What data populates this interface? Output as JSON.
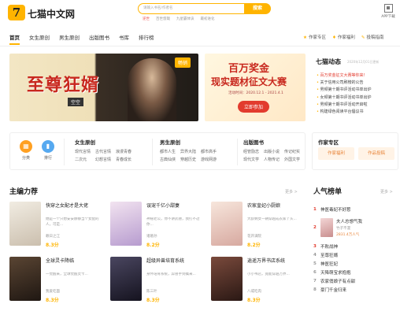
{
  "header": {
    "logo_mark": "7",
    "logo_text": "七猫中文网",
    "search_placeholder": "请输入书名/作者名",
    "search_button": "搜索",
    "hot_searches": [
      "逆世",
      "百世悠哉",
      "九星霸体诀",
      "最初进化"
    ],
    "app_download": "APP下载"
  },
  "nav": {
    "items": [
      "首页",
      "女生原创",
      "男生原创",
      "出版图书",
      "书库",
      "排行榜"
    ],
    "active_index": 0,
    "right_links": [
      {
        "icon": "★",
        "label": "作家专区"
      },
      {
        "icon": "♦",
        "label": "作家福利"
      },
      {
        "icon": "✎",
        "label": "投稿指南"
      }
    ]
  },
  "banner": {
    "title": "至尊狂婿",
    "author": "空空",
    "badge": "畅销",
    "contest_line1": "百万奖金",
    "contest_line2": "现实题材征文大赛",
    "contest_date": "活动时间：2020.12.1 - 2021.4.1",
    "contest_button": "立即参加"
  },
  "news": {
    "title": "七猫动态",
    "date": "2020年12月01日更新",
    "items": [
      "百万奖金征文大赛等你来！",
      "关于信用公司刷榜的公告",
      "男频第十期书评活动书单出炉",
      "女频第十期书评活动书单出炉",
      "男频第十期书评活动开启啦",
      "构建绿色阅读平台倡议书"
    ]
  },
  "categories": {
    "quick": [
      {
        "label": "分类",
        "color": "#ffa021",
        "icon": "▦"
      },
      {
        "label": "排行",
        "color": "#56a9f0",
        "icon": "▮"
      }
    ],
    "female_title": "女生原创",
    "female_tags": [
      "现代言情",
      "古代言情",
      "浪漫青春",
      "二次元",
      "幻想言情",
      "青春成长"
    ],
    "male_title": "男生原创",
    "male_tags": [
      "都市人生",
      "异界大陆",
      "都市高手",
      "古典仙侠",
      "穿越历史",
      "游戏网游"
    ],
    "publish_title": "出版图书",
    "publish_tags": [
      "经管励志",
      "出版小说",
      "传记纪实",
      "现代文学",
      "人物传记",
      "外国文学"
    ]
  },
  "author_zone": {
    "title": "作家专区",
    "buttons": [
      "作家福利",
      "作品投稿"
    ]
  },
  "editor_picks": {
    "title": "主编力荐",
    "more": "更多 >",
    "books": [
      {
        "title": "快穿之女配才是大佬",
        "desc": "她是一个只想安安静静当个女配的人，可是...",
        "author": "赖日之江",
        "score": "8.3分",
        "cover": "#e8e2d6"
      },
      {
        "title": "误宠千亿小甜妻",
        "desc": "神秘老公，你不讲武德，我打不过你...",
        "author": "诸葛孙",
        "score": "8.2分",
        "cover": "#d8c6e4"
      },
      {
        "title": "农家皇妃小厨娘",
        "desc": "大龄剩女一朝穿越成农家丫头...",
        "author": "花开满院",
        "score": "8.2分",
        "cover": "#efd8d0"
      },
      {
        "title": "全球灵卡降临",
        "desc": "一觉醒来，全球觉醒灵卡...",
        "author": "我爱吃面",
        "score": "8.3分",
        "cover": "#3a2d22"
      },
      {
        "title": "超级异兽培育系统",
        "desc": "身怀培育系统，异兽手到擒来...",
        "author": "陈三叶",
        "score": "8.3分",
        "cover": "#2c2a3d"
      },
      {
        "title": "逍遥万界书店系统",
        "desc": "小小书店，竟能穿越万界...",
        "author": "八戒吃肉",
        "score": "8.3分",
        "cover": "#4a2e28"
      }
    ]
  },
  "ranking": {
    "title": "人气榜单",
    "more": "更多 >",
    "items": [
      "神医毒妃不好惹",
      "夫人总想气我",
      "不败战神",
      "至尊狂婿",
      "神医狂妃",
      "天降萌宝求抱抱",
      "农家俏娘子有点甜",
      "豪门千金归来"
    ],
    "feature_author": "竹子不漫",
    "feature_hot": "2831.4万人气"
  }
}
